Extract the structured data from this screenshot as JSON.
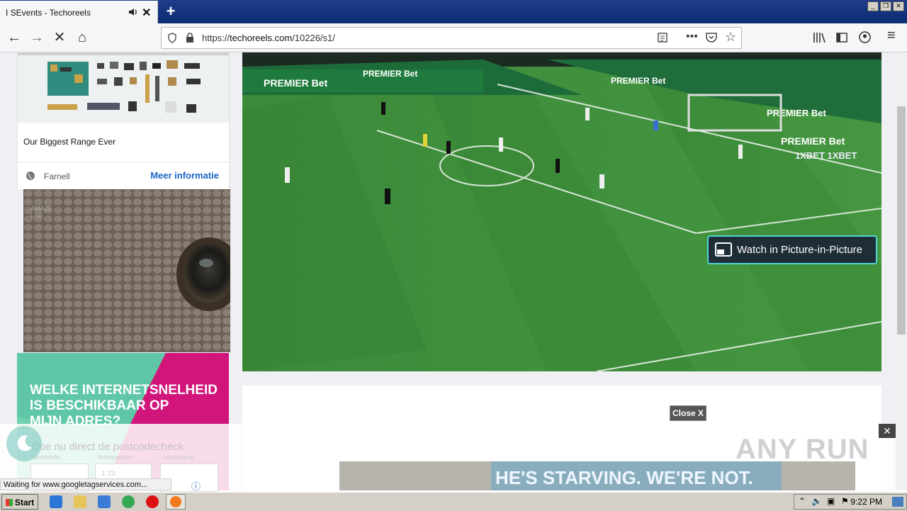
{
  "browser": {
    "tab_title": "I SEvents - Techoreels",
    "tab_close": "✕",
    "new_tab": "+",
    "url_prefix": "https://",
    "url_domain": "techoreels.com",
    "url_path": "/10226/s1/"
  },
  "ad_card": {
    "title": "Our Biggest Range Ever",
    "source": "Farnell",
    "more_link": "Meer informatie"
  },
  "kpn_ad": {
    "headline_lines": [
      "WELKE INTERNETSNELHEID",
      "IS BESCHIKBAAR OP",
      "MIJN ADRES?"
    ],
    "subtext": "Doe nu direct de postcodecheck",
    "field_labels": [
      "postcode",
      "huisnummer",
      "toevoeging"
    ],
    "field_placeholder": "1 23"
  },
  "video": {
    "pip_label": "Watch in Picture-in-Picture"
  },
  "overlay_ad": {
    "close_label": "Close X",
    "close_icon": "✕",
    "banner_text": "HE'S STARVING.  WE'RE NOT."
  },
  "status": {
    "text": "Waiting for www.googletagservices.com..."
  },
  "watermark": "ANY RUN",
  "taskbar": {
    "start_label": "Start",
    "clock": "9:22 PM"
  },
  "colors": {
    "titlebar": "#0b2b73",
    "pitch": "#3f8a3c",
    "kpn_pink": "#d2157a",
    "kpn_green": "#6fd0b0",
    "link_blue": "#1a66c7",
    "pip_border": "#4fd3d9"
  }
}
